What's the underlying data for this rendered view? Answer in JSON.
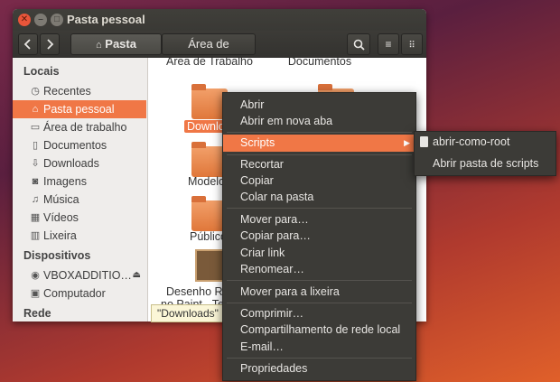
{
  "window": {
    "title": "Pasta pessoal"
  },
  "toolbar": {
    "crumbs": [
      "Pasta pessoal",
      "Área de Trabalho"
    ]
  },
  "sidebar": {
    "locais_heading": "Locais",
    "items": [
      {
        "label": "Recentes",
        "icon": "clock-icon"
      },
      {
        "label": "Pasta pessoal",
        "icon": "home-icon"
      },
      {
        "label": "Área de trabalho",
        "icon": "desktop-icon"
      },
      {
        "label": "Documentos",
        "icon": "document-icon"
      },
      {
        "label": "Downloads",
        "icon": "download-icon"
      },
      {
        "label": "Imagens",
        "icon": "camera-icon"
      },
      {
        "label": "Música",
        "icon": "music-icon"
      },
      {
        "label": "Vídeos",
        "icon": "film-icon"
      },
      {
        "label": "Lixeira",
        "icon": "trash-icon"
      }
    ],
    "dispositivos_heading": "Dispositivos",
    "devices": [
      {
        "label": "VBOXADDITIO…",
        "icon": "disc-icon"
      },
      {
        "label": "Computador",
        "icon": "drive-icon"
      }
    ],
    "rede_heading": "Rede"
  },
  "content": {
    "top_labels": [
      "Área de Trabalho",
      "Documentos"
    ],
    "items": [
      {
        "label": "Downloads"
      },
      {
        "label": "Modelos"
      },
      {
        "label": "Público"
      },
      {
        "label": "Desenho Re",
        "label2": "no Paint - Tes"
      }
    ]
  },
  "statusbar": {
    "text": "\"Downloads\""
  },
  "menu": {
    "items": [
      "Abrir",
      "Abrir em nova aba",
      "Scripts",
      "Recortar",
      "Copiar",
      "Colar na pasta",
      "Mover para…",
      "Copiar para…",
      "Criar link",
      "Renomear…",
      "Mover para a lixeira",
      "Comprimir…",
      "Compartilhamento de rede local",
      "E-mail…",
      "Propriedades"
    ]
  },
  "submenu": {
    "items": [
      "abrir-como-root",
      "Abrir pasta de scripts"
    ]
  },
  "colors": {
    "accent": "#f07746",
    "menu_bg": "#3c3b37",
    "titlebar": "#3c3b37"
  }
}
